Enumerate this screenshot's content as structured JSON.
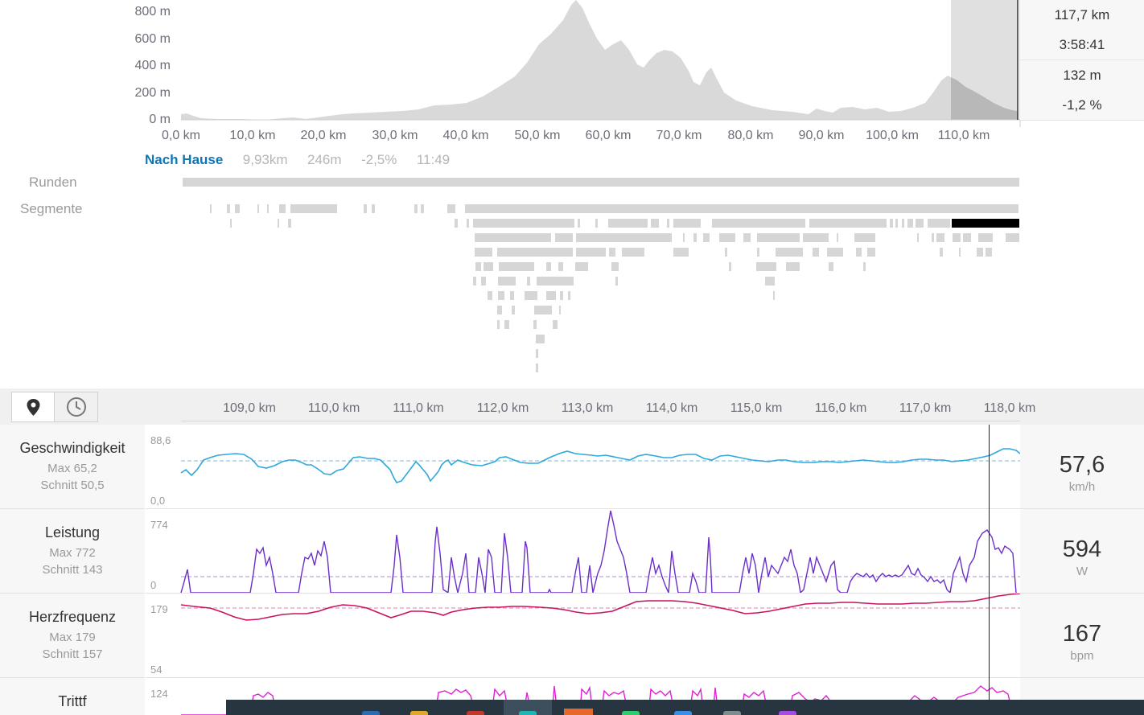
{
  "elevation": {
    "y_labels": [
      "800 m",
      "600 m",
      "400 m",
      "200 m",
      "0 m"
    ],
    "x_labels": [
      "0,0 km",
      "10,0 km",
      "20,0 km",
      "30,0 km",
      "40,0 km",
      "50,0 km",
      "60,0 km",
      "70,0 km",
      "80,0 km",
      "90,0 km",
      "100,0 km",
      "110,0 km"
    ],
    "selection_km": [
      108.0,
      117.7
    ],
    "fill_color": "#d9d9d9",
    "selection_color": "#b6b6b6"
  },
  "stats": {
    "distance": "117,7 km",
    "time": "3:58:41",
    "elevation": "132 m",
    "grade": "-1,2 %"
  },
  "segment": {
    "name": "Nach Hause",
    "distance": "9,93km",
    "elevation": "246m",
    "grade": "-2,5%",
    "time": "11:49"
  },
  "labels": {
    "laps": "Runden",
    "segments": "Segmente"
  },
  "analysis": {
    "x_labels": [
      "109,0 km",
      "110,0 km",
      "111,0 km",
      "112,0 km",
      "113,0 km",
      "114,0 km",
      "115,0 km",
      "116,0 km",
      "117,0 km",
      "118,0 km"
    ],
    "view_buttons": {
      "distance": "map-pin-icon",
      "time": "clock-icon"
    },
    "rows": [
      {
        "title": "Geschwindigkeit",
        "max": "Max 65,2",
        "avg": "Schnitt 50,5",
        "ymax": "88,6",
        "ymin": "0,0",
        "value": "57,6",
        "unit": "km/h",
        "color": "#2ea8dc"
      },
      {
        "title": "Leistung",
        "max": "Max 772",
        "avg": "Schnitt 143",
        "ymax": "774",
        "ymin": "0",
        "value": "594",
        "unit": "W",
        "color": "#6b2fc9"
      },
      {
        "title": "Herzfrequenz",
        "max": "Max 179",
        "avg": "Schnitt 157",
        "ymax": "179",
        "ymin": "54",
        "value": "167",
        "unit": "bpm",
        "color": "#c7145c"
      },
      {
        "title": "Trittf",
        "ymax": "124",
        "color": "#e01fd6"
      }
    ]
  },
  "taskbar": {
    "icon_colors": [
      "#2b6cb0",
      "#e0a92a",
      "#c0392b",
      "#1fb5b5",
      "#e8672a",
      "#2ecc71",
      "#3a8ee6",
      "#7f8c8d",
      "#a64ce0"
    ]
  }
}
